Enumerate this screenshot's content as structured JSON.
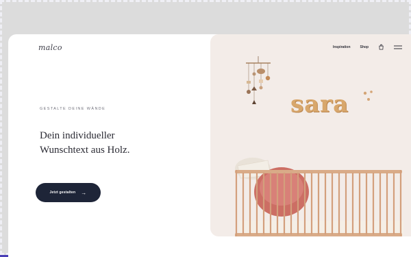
{
  "brand": {
    "logo": "malco"
  },
  "nav": {
    "items": [
      "Inspiration",
      "Shop"
    ],
    "bag_icon": "bag-icon",
    "menu_icon": "menu-icon"
  },
  "hero": {
    "eyebrow": "GESTALTE DEINE WÄNDE",
    "headline_line1": "Dein individueller",
    "headline_line2": "Wunschtext aus Holz.",
    "cta_label": "Jetzt gestalten",
    "cta_icon": "arrow-right-icon",
    "name_sign": "sara"
  },
  "colors": {
    "accent": "#1e2538",
    "wood": "#d8a76c",
    "hero_bg": "#f3ece8",
    "outer_bg": "#4a3fb6"
  }
}
